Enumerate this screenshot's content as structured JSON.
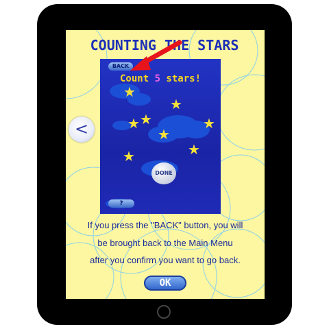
{
  "title": "COUNTING THE STARS",
  "game_screen": {
    "back_label": "BACK",
    "prompt_prefix": "Count ",
    "prompt_number": "5",
    "prompt_suffix": " stars!",
    "done_label": "DONE",
    "help_label": "?",
    "star_count": 8
  },
  "nav": {
    "prev_label": "<"
  },
  "instructions": [
    "If you press the \"BACK\" button, you will",
    "be brought back to the Main Menu",
    "after you confirm you want to go back."
  ],
  "ok_label": "OK",
  "colors": {
    "screen_bg": "#fcf7a0",
    "title": "#1c2fb8",
    "game_bg": "#2233c4",
    "star": "#f4e23a",
    "pointer_arrow": "#e8141c",
    "prompt_number": "#ef62e7"
  }
}
